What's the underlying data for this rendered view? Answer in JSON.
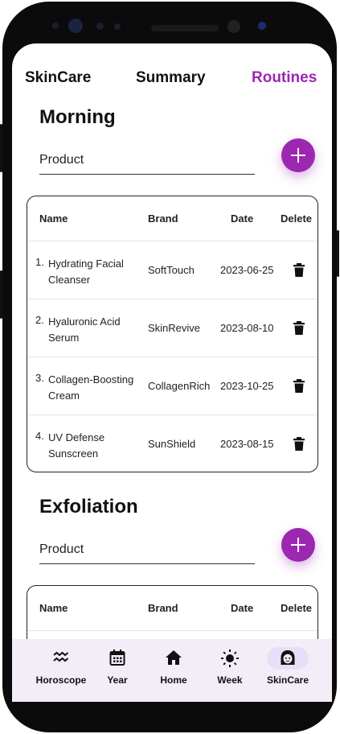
{
  "header": {
    "tabs": [
      {
        "label": "SkinCare",
        "active": false
      },
      {
        "label": "Summary",
        "active": false
      },
      {
        "label": "Routines",
        "active": true
      }
    ]
  },
  "accent_color": "#9c27b0",
  "sections": [
    {
      "title": "Morning",
      "product_placeholder": "Product",
      "add_icon": "plus-icon",
      "table": {
        "columns": [
          "Name",
          "Brand",
          "Date",
          "Delete"
        ],
        "rows": [
          {
            "num": "1.",
            "name": "Hydrating Facial Cleanser",
            "brand": "SoftTouch",
            "date": "2023-06-25"
          },
          {
            "num": "2.",
            "name": "Hyaluronic Acid Serum",
            "brand": "SkinRevive",
            "date": "2023-08-10"
          },
          {
            "num": "3.",
            "name": "Collagen-Boosting Cream",
            "brand": "CollagenRich",
            "date": "2023-10-25"
          },
          {
            "num": "4.",
            "name": "UV Defense Sunscreen",
            "brand": "SunShield",
            "date": "2023-08-15"
          }
        ]
      }
    },
    {
      "title": "Exfoliation",
      "product_placeholder": "Product",
      "add_icon": "plus-icon",
      "table": {
        "columns": [
          "Name",
          "Brand",
          "Date",
          "Delete"
        ],
        "rows": []
      }
    }
  ],
  "bottom_nav": [
    {
      "label": "Horoscope",
      "icon": "waves-icon",
      "active": false
    },
    {
      "label": "Year",
      "icon": "calendar-icon",
      "active": false
    },
    {
      "label": "Home",
      "icon": "home-icon",
      "active": false
    },
    {
      "label": "Week",
      "icon": "sun-icon",
      "active": false
    },
    {
      "label": "SkinCare",
      "icon": "face-icon",
      "active": true
    }
  ]
}
